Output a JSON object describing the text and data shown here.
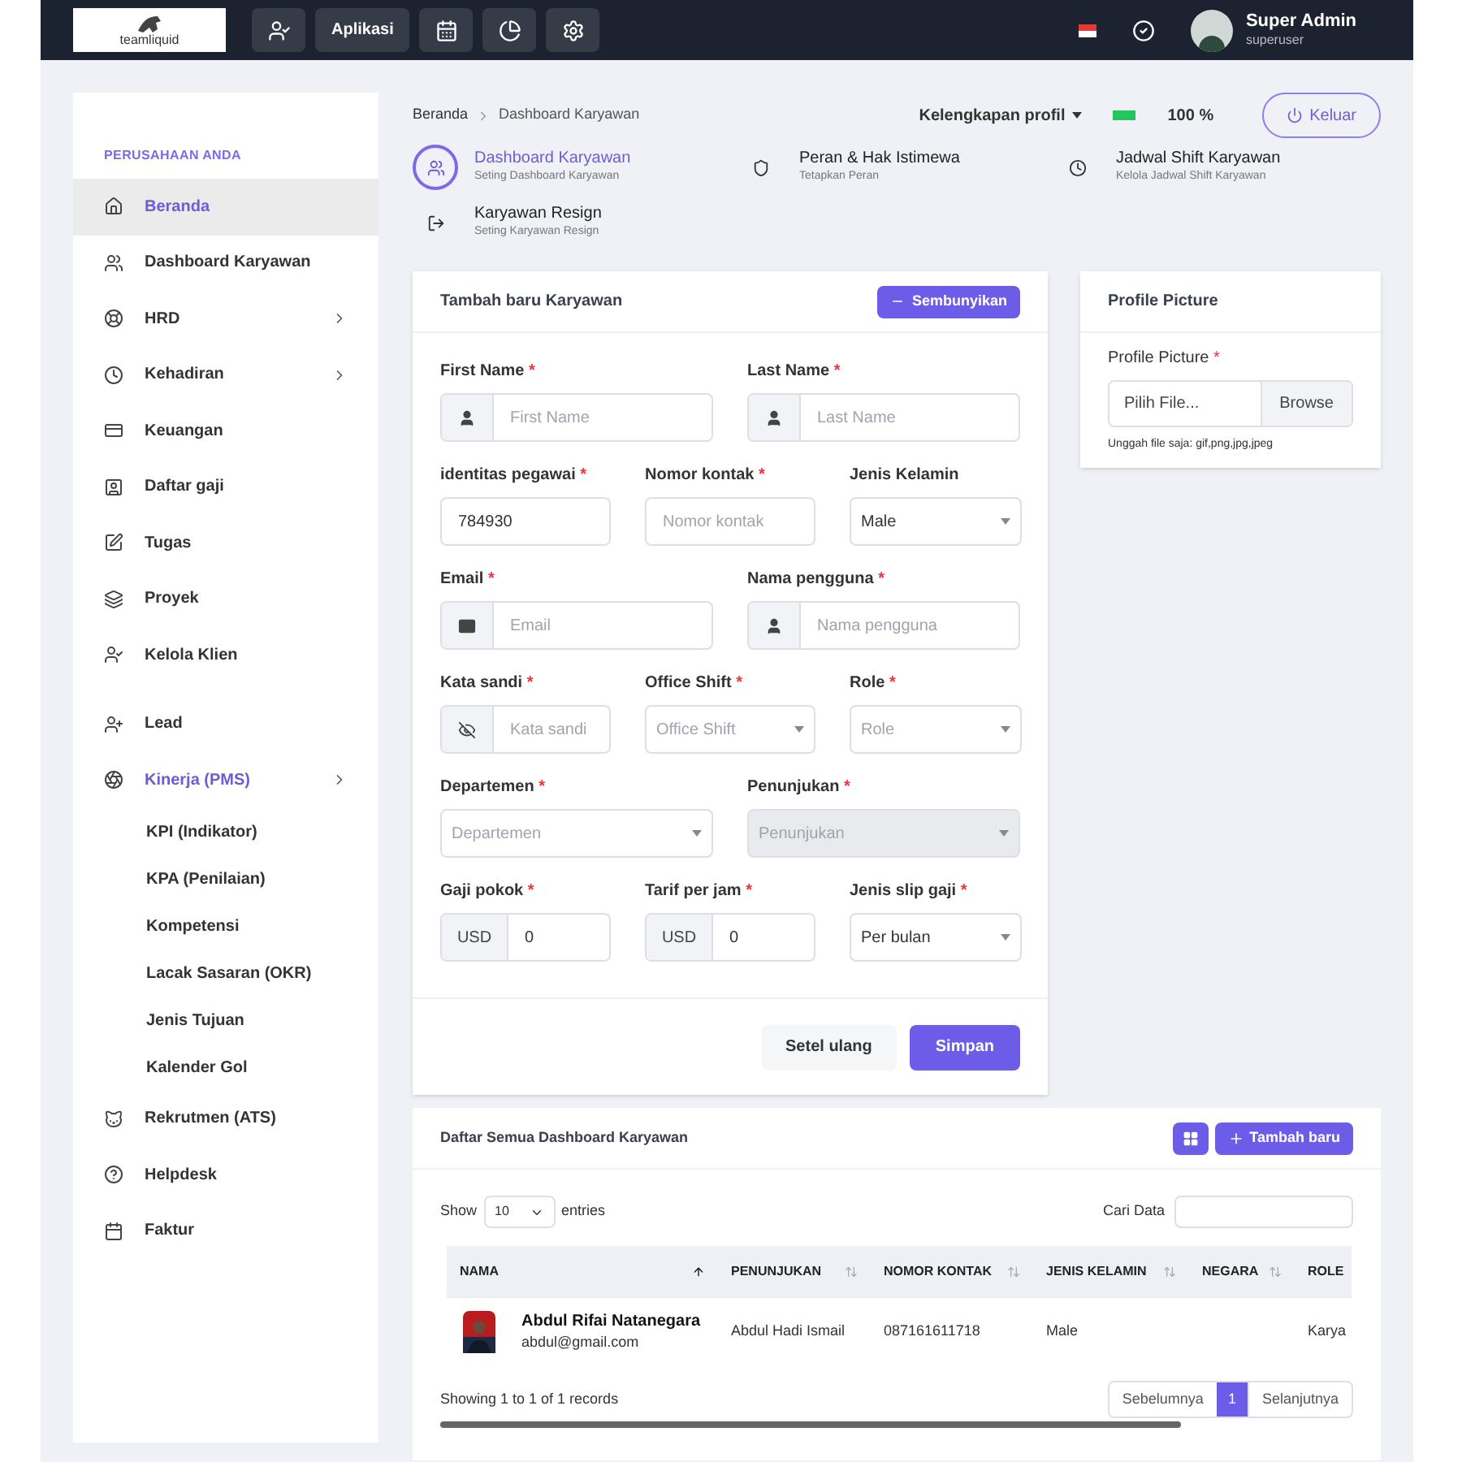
{
  "topbar": {
    "logo": "teamliquid",
    "app_button": "Aplikasi",
    "user": {
      "name": "Super Admin",
      "role": "superuser"
    }
  },
  "sidebar": {
    "section": "PERUSAHAAN ANDA",
    "items": [
      {
        "label": "Beranda",
        "selected": true,
        "expanded": false,
        "arrow": false
      },
      {
        "label": "Dashboard Karyawan",
        "selected": false,
        "expanded": false,
        "arrow": false
      },
      {
        "label": "HRD",
        "selected": false,
        "expanded": false,
        "arrow": true
      },
      {
        "label": "Kehadiran",
        "selected": false,
        "expanded": false,
        "arrow": true
      },
      {
        "label": "Keuangan",
        "selected": false,
        "expanded": false,
        "arrow": false
      },
      {
        "label": "Daftar gaji",
        "selected": false,
        "expanded": false,
        "arrow": false
      },
      {
        "label": "Tugas",
        "selected": false,
        "expanded": false,
        "arrow": false
      },
      {
        "label": "Proyek",
        "selected": false,
        "expanded": false,
        "arrow": false
      },
      {
        "label": "Kelola Klien",
        "selected": false,
        "expanded": false,
        "arrow": false
      },
      {
        "label": "Lead",
        "selected": false,
        "expanded": false,
        "arrow": false
      },
      {
        "label": "Kinerja (PMS)",
        "selected": false,
        "expanded": true,
        "arrow": true,
        "children": [
          {
            "label": "KPI (Indikator)"
          },
          {
            "label": "KPA (Penilaian)"
          },
          {
            "label": "Kompetensi"
          },
          {
            "label": "Lacak Sasaran (OKR)"
          },
          {
            "label": "Jenis Tujuan"
          },
          {
            "label": "Kalender Gol"
          }
        ]
      },
      {
        "label": "Rekrutmen (ATS)",
        "selected": false,
        "expanded": false,
        "arrow": false
      },
      {
        "label": "Helpdesk",
        "selected": false,
        "expanded": false,
        "arrow": false
      },
      {
        "label": "Faktur",
        "selected": false,
        "expanded": false,
        "arrow": false
      }
    ]
  },
  "breadcrumb": [
    "Beranda",
    "Dashboard Karyawan"
  ],
  "profile_completeness": {
    "label": "Kelengkapan profil",
    "level": 1,
    "reading": "100 %"
  },
  "logout": "Keluar",
  "quick_links": [
    {
      "title": "Dashboard Karyawan",
      "subtitle": "Seting Dashboard Karyawan",
      "selected": true
    },
    {
      "title": "Peran & Hak Istimewa",
      "subtitle": "Tetapkan Peran",
      "selected": false
    },
    {
      "title": "Jadwal Shift Karyawan",
      "subtitle": "Kelola Jadwal Shift Karyawan",
      "selected": false
    },
    {
      "title": "Karyawan Resign",
      "subtitle": "Seting Karyawan Resign",
      "selected": false
    }
  ],
  "form": {
    "title": "Tambah baru Karyawan",
    "hide_button": "Sembunyikan",
    "rows": [
      [
        {
          "label": "First Name",
          "required_mark": "*",
          "kind": "user-input",
          "placeholder": "First Name"
        },
        {
          "label": "Last Name",
          "required_mark": "*",
          "kind": "user-input",
          "placeholder": "Last Name"
        }
      ],
      [
        {
          "label": "identitas pegawai",
          "required_mark": "*",
          "kind": "input",
          "value": "784930"
        },
        {
          "label": "Nomor kontak",
          "required_mark": "*",
          "kind": "input",
          "placeholder": "Nomor kontak"
        },
        {
          "label": "Jenis Kelamin",
          "kind": "select",
          "value": "Male",
          "disabled": false
        }
      ],
      [
        {
          "label": "Email",
          "required_mark": "*",
          "kind": "email-input",
          "placeholder": "Email"
        },
        {
          "label": "Nama pengguna",
          "required_mark": "*",
          "kind": "user-input",
          "placeholder": "Nama pengguna"
        }
      ],
      [
        {
          "label": "Kata sandi",
          "required_mark": "*",
          "kind": "password-input",
          "placeholder": "Kata sandi"
        },
        {
          "label": "Office Shift",
          "required_mark": "*",
          "kind": "select",
          "placeholder": "Office Shift",
          "disabled": false
        },
        {
          "label": "Role",
          "required_mark": "*",
          "kind": "select",
          "placeholder": "Role",
          "disabled": false
        }
      ],
      [
        {
          "label": "Departemen",
          "required_mark": "*",
          "kind": "select",
          "placeholder": "Departemen",
          "disabled": false
        },
        {
          "label": "Penunjukan",
          "required_mark": "*",
          "kind": "select",
          "placeholder": "Penunjukan",
          "disabled": true
        }
      ],
      [
        {
          "label": "Gaji pokok",
          "required_mark": "*",
          "kind": "currency-input",
          "addon": "USD",
          "value": "0"
        },
        {
          "label": "Tarif per jam",
          "required_mark": "*",
          "kind": "currency-input",
          "addon": "USD",
          "value": "0"
        },
        {
          "label": "Jenis slip gaji",
          "required_mark": "*",
          "kind": "select",
          "value": "Per bulan",
          "disabled": false
        }
      ]
    ],
    "reset_button": "Setel ulang",
    "save_button": "Simpan"
  },
  "profile_picture": {
    "title": "Profile Picture",
    "label": "Profile Picture",
    "required_mark": "*",
    "file_placeholder": "Pilih File...",
    "browse_button": "Browse",
    "hint": "Unggah file saja: gif,png,jpg,jpeg"
  },
  "table": {
    "title": "Daftar Semua Dashboard Karyawan",
    "add_button": "Tambah baru",
    "show_label": "Show",
    "page_size": "10",
    "entries_label": "entries",
    "search_label": "Cari Data",
    "columns": [
      {
        "label": "NAMA",
        "sorted": true
      },
      {
        "label": "PENUNJUKAN",
        "sorted": false
      },
      {
        "label": "NOMOR KONTAK",
        "sorted": false
      },
      {
        "label": "JENIS KELAMIN",
        "sorted": false
      },
      {
        "label": "NEGARA",
        "sorted": false
      },
      {
        "label": "ROLE"
      }
    ],
    "rows": [
      {
        "name": "Abdul Rifai Natanegara",
        "email": "abdul@gmail.com",
        "penunjukan": "Abdul Hadi Ismail",
        "nomor_kontak": "087161611718",
        "jenis_kelamin": "Male",
        "role": "Karya"
      }
    ],
    "summary": "Showing 1 to 1 of 1 records",
    "prev": "Sebelumnya",
    "pages": [
      {
        "label": "1",
        "selected": true
      }
    ],
    "next": "Selanjutnya"
  }
}
